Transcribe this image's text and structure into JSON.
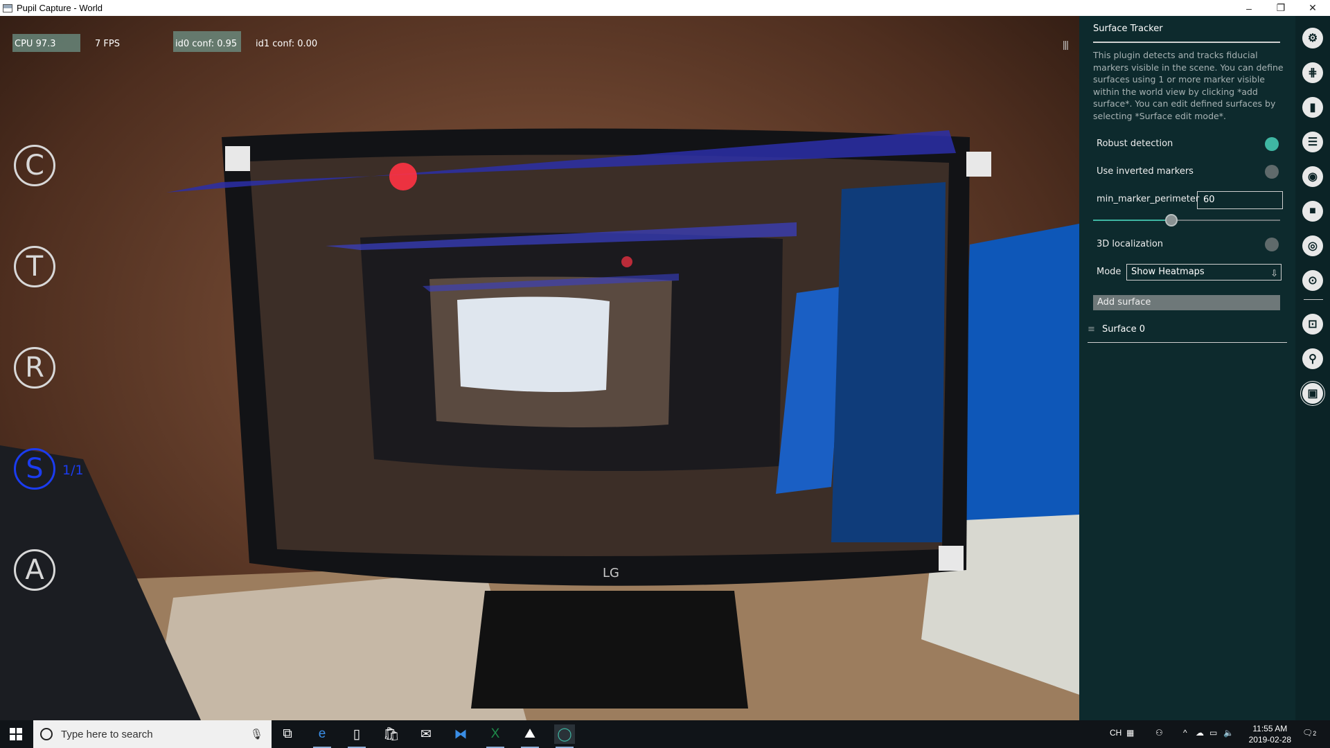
{
  "window": {
    "title": "Pupil Capture - World",
    "controls": {
      "minimize": "–",
      "restore": "❐",
      "close": "✕"
    }
  },
  "stats": {
    "cpu": "CPU 97.3",
    "fps": "7 FPS",
    "id0": "id0 conf: 0.95",
    "id1": "id1 conf: 0.00"
  },
  "menu": {
    "buttons": [
      "C",
      "T",
      "R",
      "S",
      "A"
    ],
    "active": "S",
    "s_count": "1/1",
    "collapse_handle": "|||"
  },
  "panel": {
    "title": "Surface Tracker",
    "description": "This plugin detects and tracks fiducial markers visible in the scene. You can define surfaces using 1 or more marker visible within the world view by clicking *add surface*. You can edit defined surfaces by selecting *Surface edit mode*.",
    "robust_detection": {
      "label": "Robust detection",
      "on": true
    },
    "inverted_markers": {
      "label": "Use inverted markers",
      "on": false
    },
    "min_marker_perimeter": {
      "label": "min_marker_perimeter",
      "value": "60",
      "slider_fraction": 0.42
    },
    "localization_3d": {
      "label": "3D localization",
      "on": false
    },
    "mode": {
      "label": "Mode",
      "value": "Show Heatmaps",
      "arrow": "⇩"
    },
    "add_surface": "Add surface",
    "surface": {
      "label": "Surface 0",
      "icon": "≡"
    }
  },
  "rail": {
    "icons": [
      "gear-icon",
      "calibration-grid-icon",
      "bar-chart-icon",
      "sliders-icon",
      "camera-icon",
      "video-camera-icon",
      "target-icon",
      "screen-capture-icon",
      "cast-icon",
      "link-icon",
      "surface-tracker-icon"
    ],
    "glyphs": [
      "⚙",
      "⋕",
      "▮",
      "☰",
      "◉",
      "■",
      "◎",
      "⊙",
      "⊡",
      "⚲",
      "▣"
    ]
  },
  "taskbar": {
    "search_placeholder": "Type here to search",
    "tray_lang": "CH",
    "time": "11:55 AM",
    "date": "2019-02-28",
    "notification_count": "2",
    "apps": [
      "task-view",
      "edge",
      "file-explorer",
      "store",
      "mail",
      "vscode",
      "excel",
      "photos",
      "pupil-capture"
    ]
  },
  "colors": {
    "panel_bg": "#0d2a2d",
    "accent_teal": "#3fb7a3",
    "active_blue": "#1b3cf0"
  }
}
